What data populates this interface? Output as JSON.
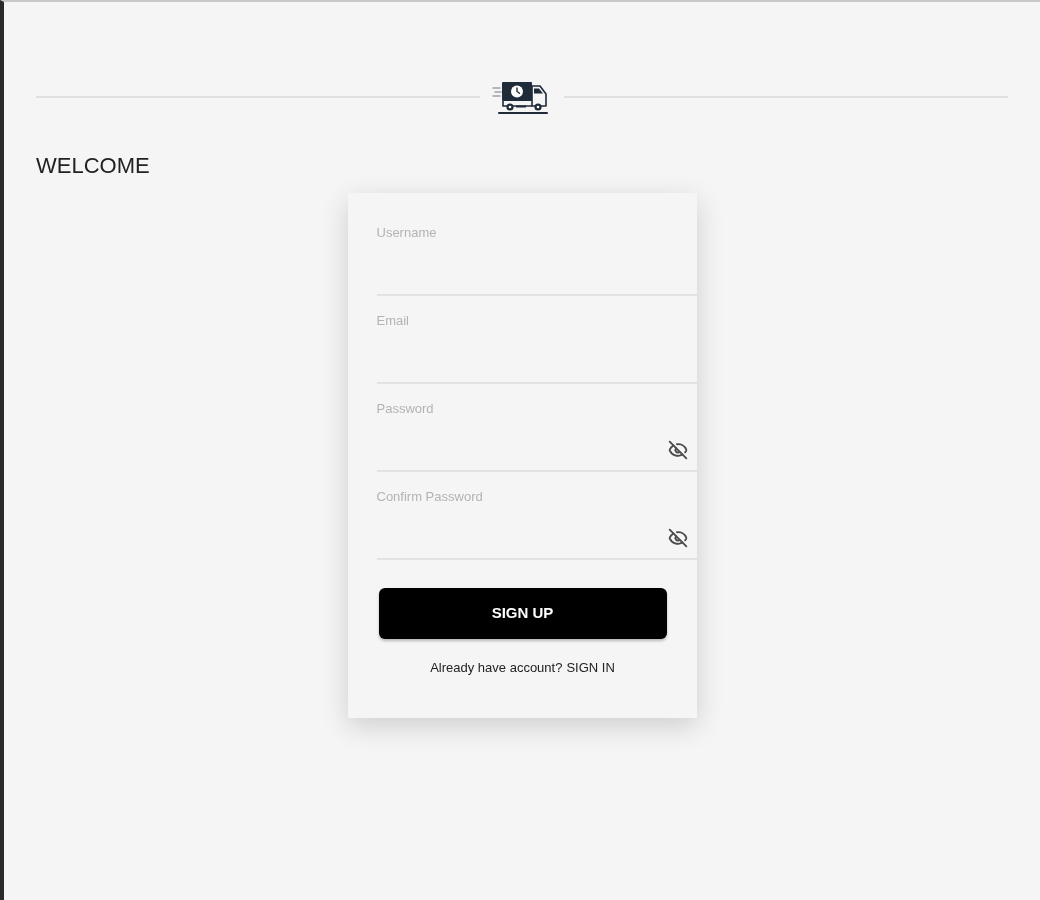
{
  "header": {
    "welcome_title": "WELCOME"
  },
  "form": {
    "fields": [
      {
        "kind": "text",
        "label": "Username"
      },
      {
        "kind": "email",
        "label": "Email"
      },
      {
        "kind": "password",
        "label": "Password"
      },
      {
        "kind": "password",
        "label": "Confirm Password"
      }
    ],
    "submit": "SIGN UP",
    "footer": {
      "prompt": "Already have account?",
      "link": "SIGN IN"
    }
  }
}
